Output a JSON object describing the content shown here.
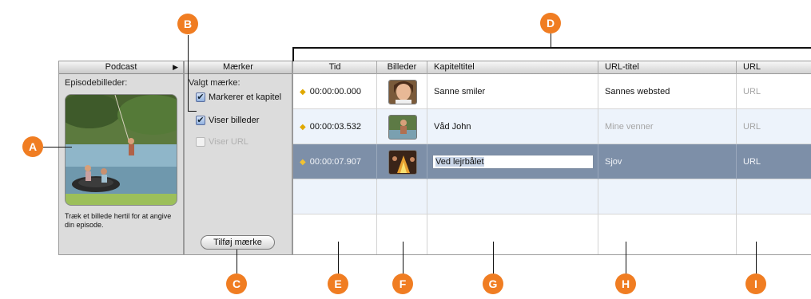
{
  "podcast_panel": {
    "header": "Podcast",
    "episode_artwork_label": "Episodebilleder:",
    "hint": "Træk et billede hertil for at angive din episode."
  },
  "markers_panel": {
    "header": "Mærker",
    "selected_marker_label": "Valgt mærke:",
    "options": [
      {
        "label": "Markerer et kapitel",
        "checked": true,
        "enabled": true
      },
      {
        "label": "Viser billeder",
        "checked": true,
        "enabled": true
      },
      {
        "label": "Viser URL",
        "checked": false,
        "enabled": false
      }
    ],
    "add_button": "Tilføj mærke"
  },
  "table": {
    "columns": [
      "Tid",
      "Billeder",
      "Kapiteltitel",
      "URL-titel",
      "URL"
    ],
    "rows": [
      {
        "time": "00:00:00.000",
        "title": "Sanne smiler",
        "url_title": "Sannes websted",
        "url": "URL",
        "url_title_placeholder": false
      },
      {
        "time": "00:00:03.532",
        "title": "Våd John",
        "url_title": "Mine venner",
        "url": "URL",
        "url_title_placeholder": true
      },
      {
        "time": "00:00:07.907",
        "title": "Ved lejrbålet",
        "url_title": "Sjov",
        "url": "URL",
        "url_title_placeholder": true,
        "selected": true
      }
    ]
  },
  "callouts": [
    "A",
    "B",
    "C",
    "D",
    "E",
    "F",
    "G",
    "H",
    "I"
  ],
  "icons": {
    "marker": "diamond-icon",
    "disclosure": "triangle-right-icon",
    "checkbox": "checkmark-icon"
  },
  "colors": {
    "callout": "#f07d22",
    "selected_row": "#7d8fa8",
    "alt_row": "#edf3fb",
    "marker_diamond": "#e0a800"
  }
}
